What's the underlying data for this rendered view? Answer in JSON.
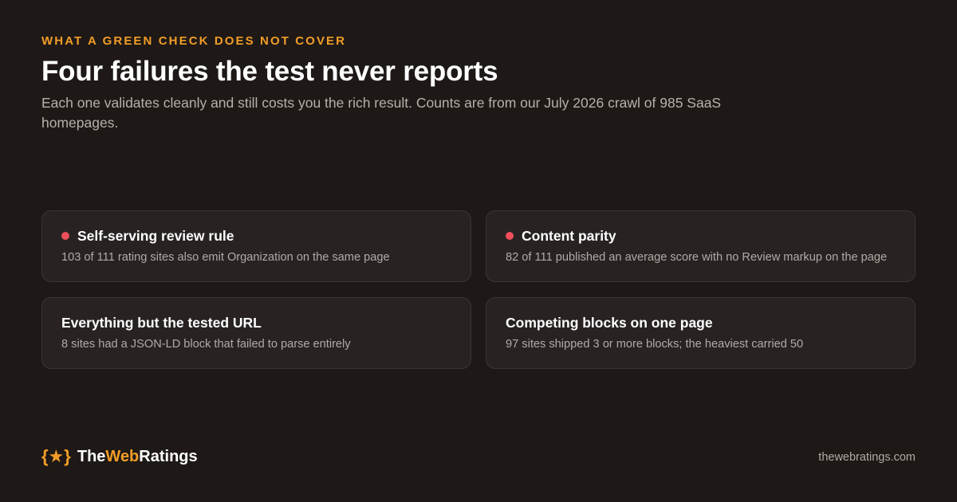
{
  "header": {
    "eyebrow": "WHAT A GREEN CHECK DOES NOT COVER",
    "title": "Four failures the test never reports",
    "subtitle": "Each one validates cleanly and still costs you the rich result. Counts are from our July 2026 crawl of 985 SaaS homepages."
  },
  "cards": [
    {
      "title": "Self-serving review rule",
      "description": "103 of 111 rating sites also emit Organization on the same page",
      "flagged": true
    },
    {
      "title": "Content parity",
      "description": "82 of 111 published an average score with no Review markup on the page",
      "flagged": true
    },
    {
      "title": "Everything but the tested URL",
      "description": "8 sites had a JSON-LD block that failed to parse entirely",
      "flagged": false
    },
    {
      "title": "Competing blocks on one page",
      "description": "97 sites shipped 3 or more blocks; the heaviest carried 50",
      "flagged": false
    }
  ],
  "footer": {
    "brand_icon": "{★}",
    "brand_part1": "The",
    "brand_part2": "Web",
    "brand_part3": "Ratings",
    "url": "thewebratings.com"
  },
  "colors": {
    "background": "#1e1917",
    "accent": "#f29d27",
    "flag": "#ef4f5a",
    "card": "#282322"
  }
}
